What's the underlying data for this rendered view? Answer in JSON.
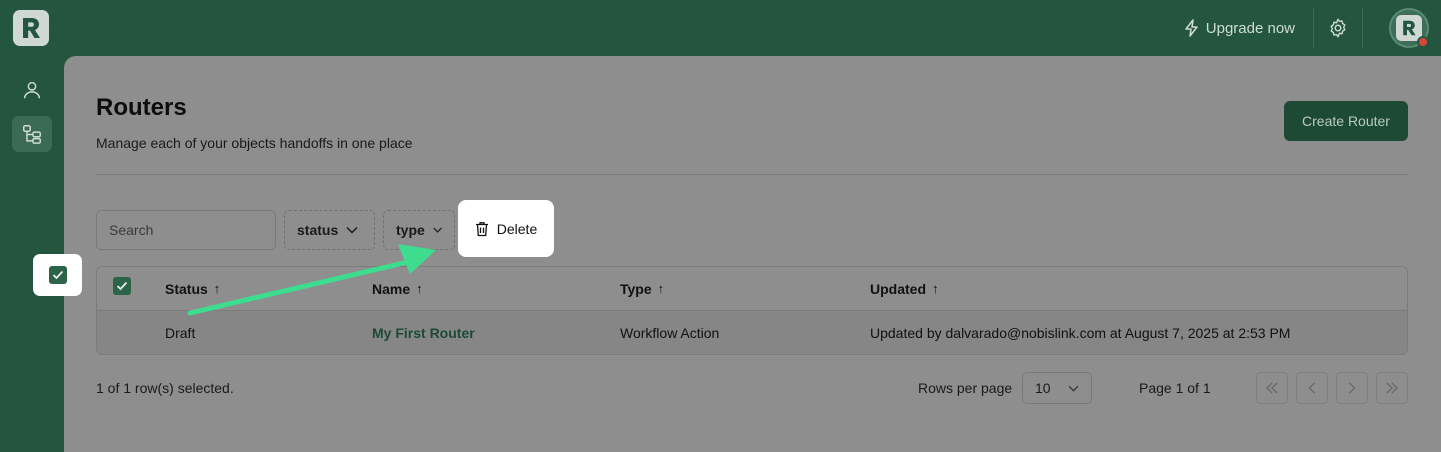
{
  "topbar": {
    "upgrade_label": "Upgrade now"
  },
  "page": {
    "title": "Routers",
    "subtitle": "Manage each of your objects handoffs in one place",
    "create_button": "Create Router"
  },
  "filters": {
    "search_placeholder": "Search",
    "status_label": "status",
    "type_label": "type",
    "delete_label": "Delete"
  },
  "table": {
    "columns": [
      "Status",
      "Name",
      "Type",
      "Updated"
    ],
    "rows": [
      {
        "status": "Draft",
        "name": "My First Router",
        "type": "Workflow Action",
        "updated": "Updated by dalvarado@nobislink.com at August 7, 2025 at 2:53 PM",
        "selected": true
      }
    ]
  },
  "footer": {
    "selection_text": "1 of 1 row(s) selected.",
    "rows_per_page_label": "Rows per page",
    "rows_per_page_value": "10",
    "page_info": "Page 1 of 1"
  },
  "colors": {
    "brand": "#24553f",
    "primary_button": "#1d4a35",
    "annotation_arrow": "#3ddc8f",
    "avatar_status": "#d9443b"
  }
}
